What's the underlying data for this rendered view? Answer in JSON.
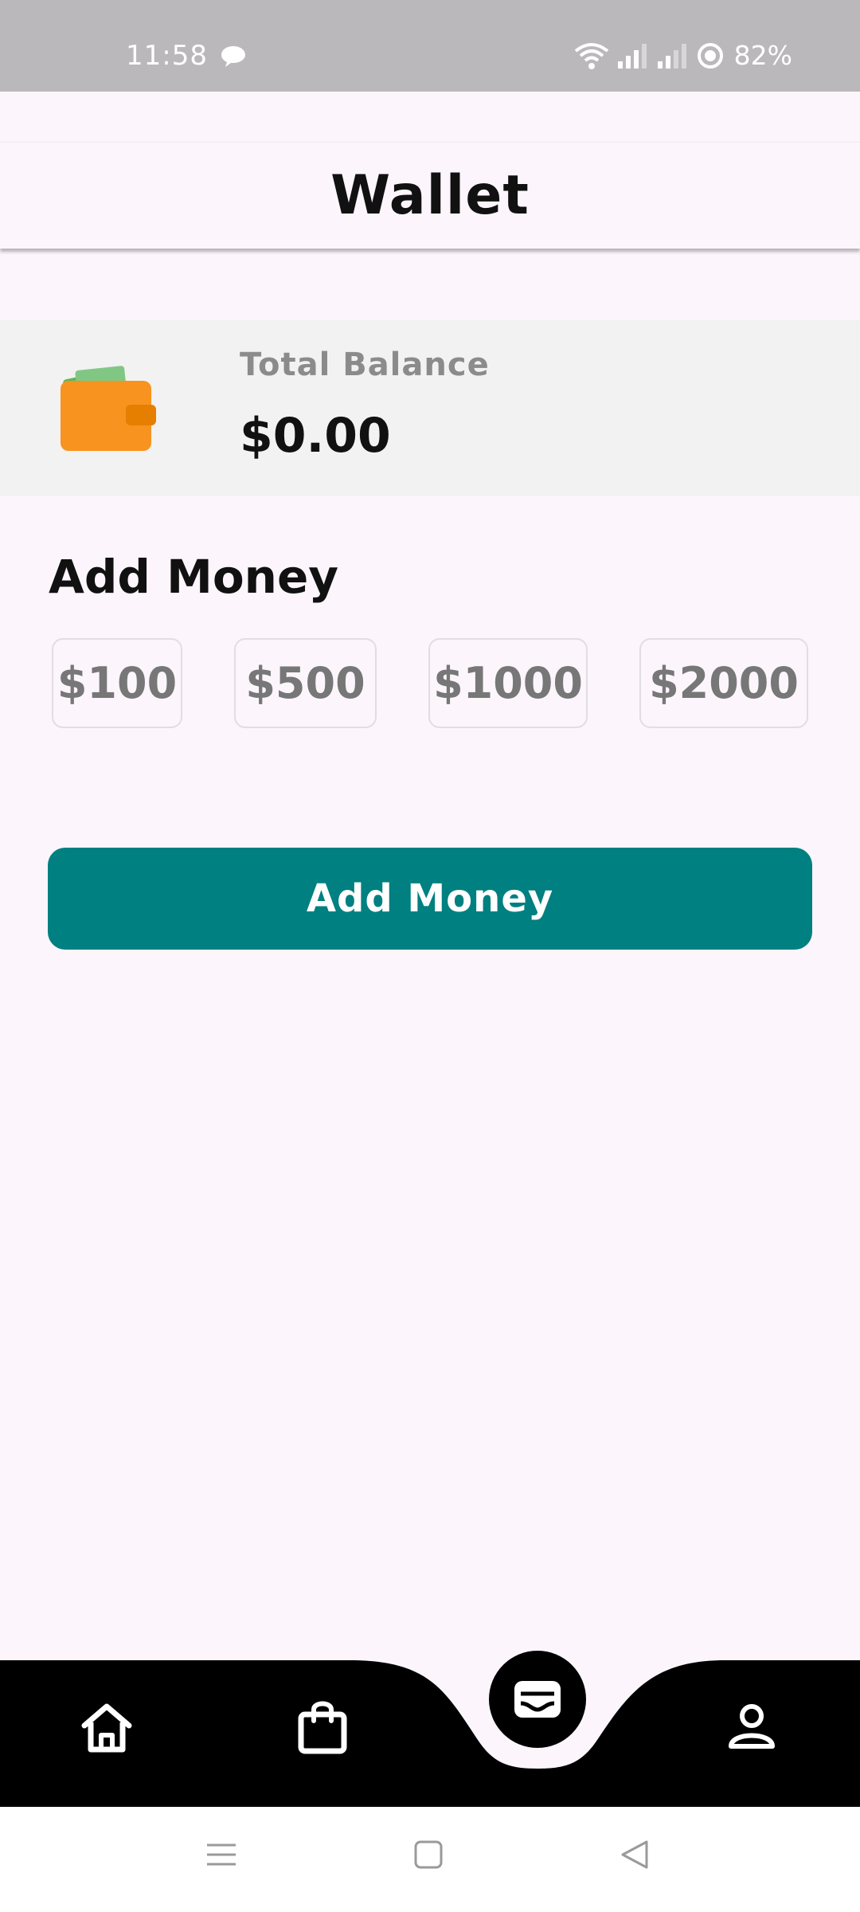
{
  "status_bar": {
    "time": "11:58",
    "battery": "82%"
  },
  "header": {
    "title": "Wallet"
  },
  "balance": {
    "label": "Total Balance",
    "value": "$0.00"
  },
  "add_money": {
    "section_title": "Add Money",
    "amounts": [
      "$100",
      "$500",
      "$1000",
      "$2000"
    ],
    "button_label": "Add Money"
  },
  "bottom_nav": {
    "items": [
      "home-icon",
      "shopping-bag-icon",
      "wallet-icon",
      "profile-icon"
    ],
    "active": "wallet-icon"
  },
  "colors": {
    "accent": "#008080",
    "background": "#fcf6fc",
    "status_bar": "#bbb8bc",
    "card": "#f2f2f2",
    "wallet_orange": "#f7931e"
  }
}
